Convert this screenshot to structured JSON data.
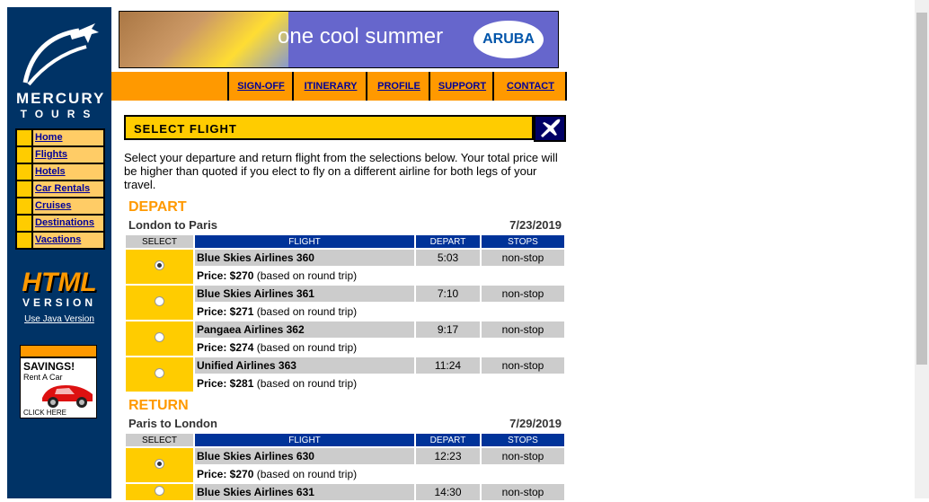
{
  "brand": {
    "line1": "MERCURY",
    "line2": "TOURS"
  },
  "side_nav": [
    "Home",
    "Flights",
    "Hotels",
    "Car Rentals",
    "Cruises",
    "Destinations",
    "Vacations"
  ],
  "html_version": {
    "big": "HTML",
    "sub": "VERSION",
    "link": "Use Java Version"
  },
  "ad": {
    "title": "SAVINGS!",
    "sub": "Rent A Car",
    "cta": "CLICK HERE"
  },
  "banner": {
    "slogan": "one cool summer",
    "badge": "ARUBA"
  },
  "top_nav": [
    "SIGN-OFF",
    "ITINERARY",
    "PROFILE",
    "SUPPORT",
    "CONTACT"
  ],
  "page_title": "SELECT FLIGHT",
  "intro": "Select your departure and return flight from the selections below. Your total price will be higher than quoted if you elect to fly on a different airline for both legs of your travel.",
  "columns": {
    "select": "SELECT",
    "flight": "FLIGHT",
    "depart": "DEPART",
    "stops": "STOPS"
  },
  "depart": {
    "heading": "DEPART",
    "route": "London to Paris",
    "date": "7/23/2019",
    "flights": [
      {
        "name": "Blue Skies Airlines 360",
        "time": "5:03",
        "stops": "non-stop",
        "price_label": "Price: $270",
        "price_note": "(based on round trip)",
        "selected": true
      },
      {
        "name": "Blue Skies Airlines 361",
        "time": "7:10",
        "stops": "non-stop",
        "price_label": "Price: $271",
        "price_note": "(based on round trip)",
        "selected": false
      },
      {
        "name": "Pangaea Airlines 362",
        "time": "9:17",
        "stops": "non-stop",
        "price_label": "Price: $274",
        "price_note": "(based on round trip)",
        "selected": false
      },
      {
        "name": "Unified Airlines 363",
        "time": "11:24",
        "stops": "non-stop",
        "price_label": "Price: $281",
        "price_note": "(based on round trip)",
        "selected": false
      }
    ]
  },
  "return": {
    "heading": "RETURN",
    "route": "Paris to London",
    "date": "7/29/2019",
    "flights": [
      {
        "name": "Blue Skies Airlines 630",
        "time": "12:23",
        "stops": "non-stop",
        "price_label": "Price: $270",
        "price_note": "(based on round trip)",
        "selected": true
      },
      {
        "name": "Blue Skies Airlines 631",
        "time": "14:30",
        "stops": "non-stop",
        "price_label": "",
        "price_note": "",
        "selected": false
      }
    ]
  },
  "colors": {
    "sidebar": "#003366",
    "accent": "#ffcc00",
    "orange": "#ff9900",
    "header_blue": "#003399"
  }
}
